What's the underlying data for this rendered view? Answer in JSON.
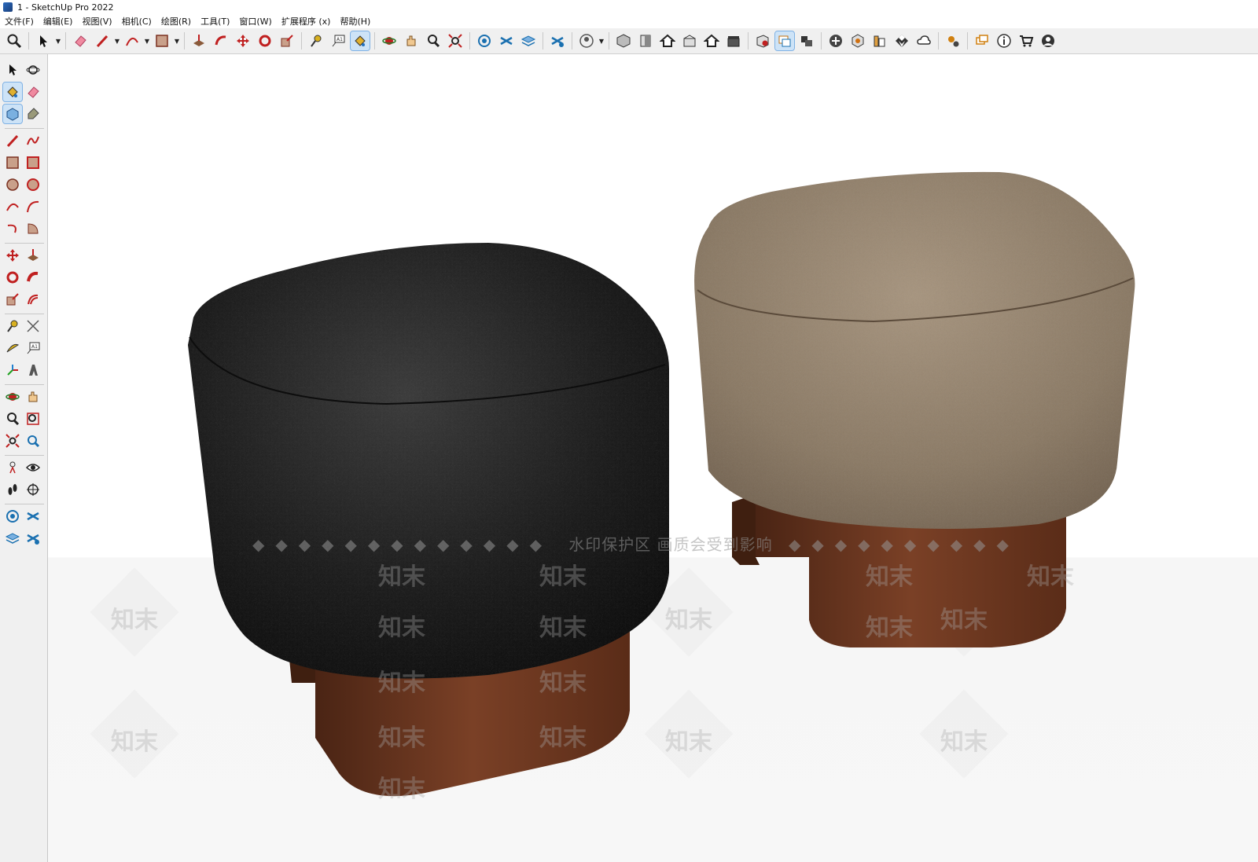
{
  "window": {
    "title": "1 - SketchUp Pro 2022"
  },
  "menu": {
    "items": [
      "文件(F)",
      "编辑(E)",
      "视图(V)",
      "相机(C)",
      "绘图(R)",
      "工具(T)",
      "窗口(W)",
      "扩展程序 (x)",
      "帮助(H)"
    ]
  },
  "viewport": {
    "watermark_banner": "水印保护区   画质会受到影响",
    "watermark_logo": "知末"
  },
  "colors": {
    "toolbar_bg": "#f0f0f0",
    "active_tool": "#cde3f7",
    "stool_dark_cushion": "#1a1a1a",
    "stool_light_cushion": "#8f7f6c",
    "wood": "#6b3a22"
  },
  "icons": {
    "top_toolbar": [
      "zoom-icon",
      "select-icon",
      "eraser-icon",
      "pencil-icon",
      "arc-icon",
      "rectangle-icon",
      "push-pull-icon",
      "follow-me-icon",
      "move-icon",
      "rotate-icon",
      "scale-icon",
      "tape-measure-icon",
      "text-icon",
      "paint-bucket-icon",
      "orbit-icon",
      "pan-icon",
      "zoom-window-icon",
      "zoom-extents-icon",
      "section-plane-icon",
      "style-icon",
      "layer-icon",
      "component-icon",
      "user-icon",
      "iso-view-icon",
      "front-view-icon",
      "home-icon",
      "right-view-icon",
      "back-view-icon",
      "left-view-icon",
      "scene-icon",
      "model-info-icon",
      "camera-icon",
      "add-icon",
      "solid-tools-icon",
      "report-icon",
      "checker-icon",
      "cloud-icon",
      "extension-icon",
      "comment-icon",
      "info-icon",
      "cart-icon",
      "account-icon"
    ],
    "left_toolbar": [
      "select-icon",
      "orbit-icon",
      "paint-bucket-icon",
      "eraser-icon",
      "component-icon",
      "tag-icon",
      "line-icon",
      "freehand-icon",
      "rectangle-icon",
      "rotated-rectangle-icon",
      "circle-icon",
      "polygon-icon",
      "arc-icon",
      "two-point-arc-icon",
      "three-point-arc-icon",
      "pie-icon",
      "move-icon",
      "push-pull-icon",
      "rotate-icon",
      "follow-me-icon",
      "scale-icon",
      "offset-icon",
      "tape-measure-icon",
      "dimension-icon",
      "protractor-icon",
      "text-icon",
      "axes-icon",
      "3d-text-icon",
      "orbit-icon",
      "pan-icon",
      "zoom-icon",
      "zoom-window-icon",
      "zoom-extents-icon",
      "previous-view-icon",
      "position-camera-icon",
      "look-around-icon",
      "walk-icon",
      "section-plane-icon",
      "section-display-icon",
      "styles-icon",
      "scene-update-icon"
    ]
  }
}
